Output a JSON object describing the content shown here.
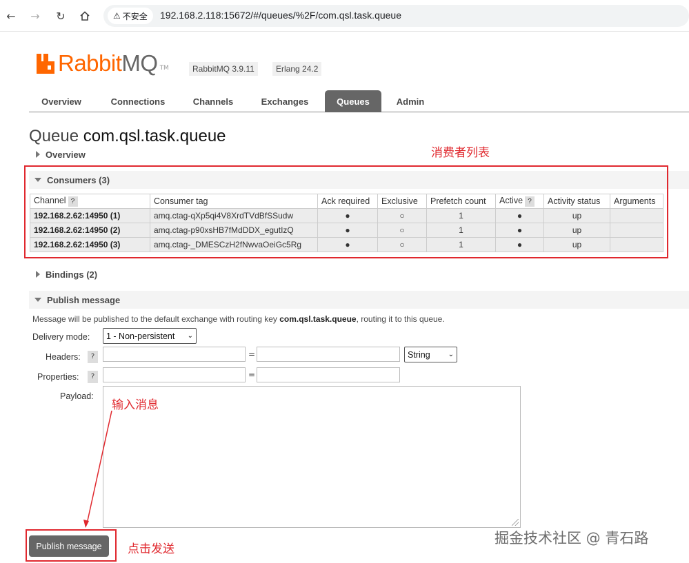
{
  "browser": {
    "security_label": "不安全",
    "url": "192.168.2.118:15672/#/queues/%2F/com.qsl.task.queue"
  },
  "header": {
    "logo_rabbit": "Rabbit",
    "logo_mq": "MQ",
    "logo_tm": "TM",
    "version": "RabbitMQ 3.9.11",
    "erlang": "Erlang 24.2"
  },
  "tabs": [
    {
      "label": "Overview",
      "active": false
    },
    {
      "label": "Connections",
      "active": false
    },
    {
      "label": "Channels",
      "active": false
    },
    {
      "label": "Exchanges",
      "active": false
    },
    {
      "label": "Queues",
      "active": true
    },
    {
      "label": "Admin",
      "active": false
    }
  ],
  "page": {
    "title_prefix": "Queue",
    "queue_name": "com.qsl.task.queue"
  },
  "sections": {
    "overview": "Overview",
    "consumers": "Consumers (3)",
    "bindings": "Bindings (2)",
    "publish": "Publish message"
  },
  "consumers_table": {
    "headers": [
      "Channel",
      "Consumer tag",
      "Ack required",
      "Exclusive",
      "Prefetch count",
      "Active",
      "Activity status",
      "Arguments"
    ],
    "help_mark": "?",
    "rows": [
      {
        "channel": "192.168.2.62:14950 (1)",
        "tag": "amq.ctag-qXp5qi4V8XrdTVdBfSSudw",
        "ack": "●",
        "exclusive": "○",
        "prefetch": "1",
        "active": "●",
        "status": "up",
        "args": ""
      },
      {
        "channel": "192.168.2.62:14950 (2)",
        "tag": "amq.ctag-p90xsHB7fMdDDX_egutIzQ",
        "ack": "●",
        "exclusive": "○",
        "prefetch": "1",
        "active": "●",
        "status": "up",
        "args": ""
      },
      {
        "channel": "192.168.2.62:14950 (3)",
        "tag": "amq.ctag-_DMESCzH2fNwvaOeiGc5Rg",
        "ack": "●",
        "exclusive": "○",
        "prefetch": "1",
        "active": "●",
        "status": "up",
        "args": ""
      }
    ]
  },
  "publish": {
    "info_prefix": "Message will be published to the default exchange with routing key ",
    "info_key": "com.qsl.task.queue",
    "info_suffix": ", routing it to this queue.",
    "delivery_label": "Delivery mode:",
    "delivery_value": "1 - Non-persistent",
    "headers_label": "Headers:",
    "properties_label": "Properties:",
    "payload_label": "Payload:",
    "header_type": "String",
    "equals": "=",
    "button": "Publish message"
  },
  "annotations": {
    "consumer_list": "消费者列表",
    "input_message": "输入消息",
    "click_send": "点击发送",
    "watermark": "掘金技术社区 @ 青石路"
  },
  "colors": {
    "accent_orange": "#ff6600",
    "tab_active": "#666666",
    "annotation_red": "#e0282e"
  }
}
